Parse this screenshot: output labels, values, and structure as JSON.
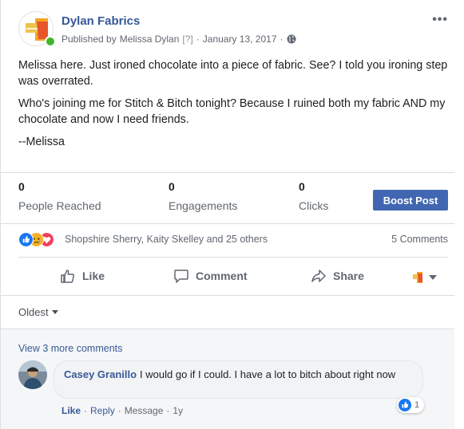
{
  "post": {
    "page_name": "Dylan Fabrics",
    "published_prefix": "Published by",
    "author": "Melissa Dylan",
    "help_marker": "[?]",
    "date": "January 13, 2017",
    "separator": "·",
    "audience_icon": "globe-icon",
    "paragraphs": [
      "Melissa here. Just ironed chocolate into a piece of fabric. See? I told you ironing step was overrated.",
      "Who's joining me for Stitch & Bitch tonight? Because I ruined both my fabric AND my chocolate and now I need friends.",
      "--Melissa"
    ]
  },
  "insights": {
    "people_reached": {
      "value": "0",
      "label": "People Reached"
    },
    "engagements": {
      "value": "0",
      "label": "Engagements"
    },
    "clicks": {
      "value": "0",
      "label": "Clicks"
    },
    "boost_label": "Boost Post"
  },
  "reactions": {
    "icons": [
      "like-reaction-icon",
      "sad-reaction-icon",
      "love-reaction-icon"
    ],
    "names": "Shopshire Sherry, Kaity Skelley and 25 others",
    "comments": "5 Comments"
  },
  "actions": {
    "like": "Like",
    "comment": "Comment",
    "share": "Share"
  },
  "comments": {
    "sort": "Oldest",
    "view_more": "View 3 more comments",
    "items": [
      {
        "name": "Casey Granillo",
        "text": "I would go if I could. I have a lot to bitch about right now",
        "like_label": "Like",
        "reply_label": "Reply",
        "message_label": "Message",
        "time": "1y",
        "reaction_count": "1"
      }
    ]
  },
  "colors": {
    "link": "#365899",
    "boost": "#4267b2",
    "online": "#42b72a",
    "like": "#1877f2",
    "love": "#f33e58",
    "sad": "#f7b125"
  }
}
